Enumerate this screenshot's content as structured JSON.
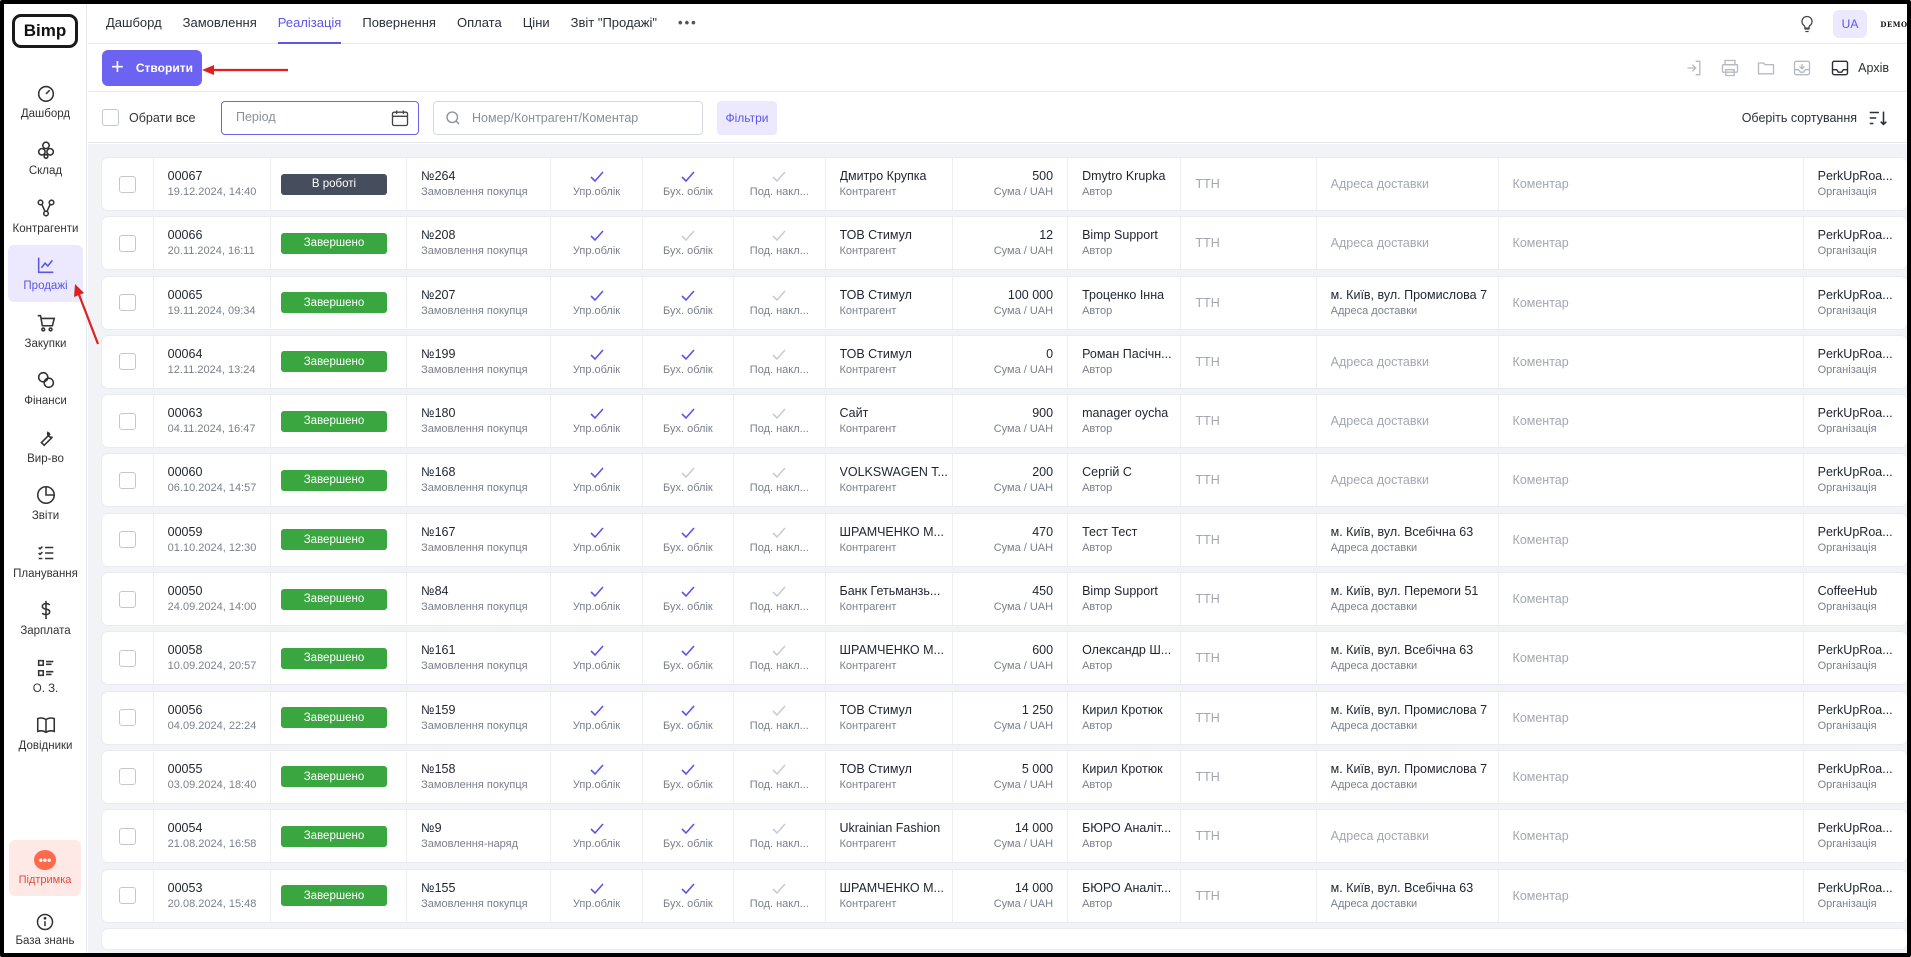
{
  "logo": "Bimp",
  "sidebar": {
    "items": [
      {
        "label": "Дашборд",
        "icon": "speedometer-icon",
        "active": false
      },
      {
        "label": "Склад",
        "icon": "boxes-icon",
        "active": false
      },
      {
        "label": "Контрагенти",
        "icon": "network-icon",
        "active": false
      },
      {
        "label": "Продажі",
        "icon": "chart-line-icon",
        "active": true
      },
      {
        "label": "Закупки",
        "icon": "cart-icon",
        "active": false
      },
      {
        "label": "Фінанси",
        "icon": "coins-icon",
        "active": false
      },
      {
        "label": "Вир-во",
        "icon": "wrench-icon",
        "active": false
      },
      {
        "label": "Звіти",
        "icon": "pie-chart-icon",
        "active": false
      },
      {
        "label": "Планування",
        "icon": "checklist-icon",
        "active": false
      },
      {
        "label": "Зарплата",
        "icon": "dollar-icon",
        "active": false
      },
      {
        "label": "О. З.",
        "icon": "grid-list-icon",
        "active": false
      },
      {
        "label": "Довідники",
        "icon": "book-icon",
        "active": false
      }
    ],
    "support_label": "Підтримка",
    "knowledge_label": "База знань"
  },
  "topnav": {
    "tabs": [
      {
        "label": "Дашборд",
        "active": false
      },
      {
        "label": "Замовлення",
        "active": false
      },
      {
        "label": "Реалізація",
        "active": true
      },
      {
        "label": "Повернення",
        "active": false
      },
      {
        "label": "Оплата",
        "active": false
      },
      {
        "label": "Ціни",
        "active": false
      },
      {
        "label": "Звіт \"Продажі\"",
        "active": false
      }
    ],
    "more": "•••",
    "lang": "UA",
    "demo": "DEMO"
  },
  "actions": {
    "create_label": "Створити",
    "archive_label": "Архів"
  },
  "filters": {
    "select_all": "Обрати все",
    "period_placeholder": "Період",
    "search_placeholder": "Номер/Контрагент/Коментар",
    "filters_label": "Фільтри",
    "sort_label": "Оберіть сортування"
  },
  "labels": {
    "upr": "Упр.облік",
    "buh": "Бух. облік",
    "pod": "Под. накл...",
    "counterparty": "Контрагент",
    "sum": "Сума / UAH",
    "author": "Автор",
    "ttn": "ТТН",
    "address": "Адреса доставки",
    "comment": "Коментар",
    "org": "Організація"
  },
  "colors": {
    "accent": "#6c63f2",
    "done": "#3aa640",
    "in_work": "#464e5e",
    "check_on": "#5b55e8",
    "check_off": "#c9ccd4"
  },
  "rows": [
    {
      "num": "00067",
      "date": "19.12.2024, 14:40",
      "status": "В роботі",
      "status_type": "work",
      "doc": "№264",
      "doc_type": "Замовлення покупця",
      "upr": true,
      "buh": true,
      "pod": false,
      "counterparty": "Дмитро Крупка",
      "sum": "500",
      "author": "Dmytro Krupka",
      "address": "",
      "org": "PerkUpRoa..."
    },
    {
      "num": "00066",
      "date": "20.11.2024, 16:11",
      "status": "Завершено",
      "status_type": "done",
      "doc": "№208",
      "doc_type": "Замовлення покупця",
      "upr": true,
      "buh": false,
      "pod": false,
      "counterparty": "ТОВ Стимул",
      "sum": "12",
      "author": "Bimp Support",
      "address": "",
      "org": "PerkUpRoa..."
    },
    {
      "num": "00065",
      "date": "19.11.2024, 09:34",
      "status": "Завершено",
      "status_type": "done",
      "doc": "№207",
      "doc_type": "Замовлення покупця",
      "upr": true,
      "buh": true,
      "pod": false,
      "counterparty": "ТОВ Стимул",
      "sum": "100 000",
      "author": "Троценко Інна",
      "address": "м. Київ, вул. Промислова 7",
      "org": "PerkUpRoa..."
    },
    {
      "num": "00064",
      "date": "12.11.2024, 13:24",
      "status": "Завершено",
      "status_type": "done",
      "doc": "№199",
      "doc_type": "Замовлення покупця",
      "upr": true,
      "buh": true,
      "pod": false,
      "counterparty": "ТОВ Стимул",
      "sum": "0",
      "author": "Роман Пасічн...",
      "address": "",
      "org": "PerkUpRoa..."
    },
    {
      "num": "00063",
      "date": "04.11.2024, 16:47",
      "status": "Завершено",
      "status_type": "done",
      "doc": "№180",
      "doc_type": "Замовлення покупця",
      "upr": true,
      "buh": true,
      "pod": false,
      "counterparty": "Сайт",
      "sum": "900",
      "author": "manager oycha",
      "address": "",
      "org": "PerkUpRoa..."
    },
    {
      "num": "00060",
      "date": "06.10.2024, 14:57",
      "status": "Завершено",
      "status_type": "done",
      "doc": "№168",
      "doc_type": "Замовлення покупця",
      "upr": true,
      "buh": false,
      "pod": false,
      "counterparty": "VOLKSWAGEN T...",
      "sum": "200",
      "author": "Сергій С",
      "address": "",
      "org": "PerkUpRoa..."
    },
    {
      "num": "00059",
      "date": "01.10.2024, 12:30",
      "status": "Завершено",
      "status_type": "done",
      "doc": "№167",
      "doc_type": "Замовлення покупця",
      "upr": true,
      "buh": true,
      "pod": false,
      "counterparty": "ШРАМЧЕНКО М...",
      "sum": "470",
      "author": "Тест Тест",
      "address": "м. Київ, вул. Всебічна 63",
      "org": "PerkUpRoa..."
    },
    {
      "num": "00050",
      "date": "24.09.2024, 14:00",
      "status": "Завершено",
      "status_type": "done",
      "doc": "№84",
      "doc_type": "Замовлення покупця",
      "upr": true,
      "buh": true,
      "pod": false,
      "counterparty": "Банк Гетьманзь...",
      "sum": "450",
      "author": "Bimp Support",
      "address": "м. Київ, вул. Перемоги 51",
      "org": "CoffeeHub"
    },
    {
      "num": "00058",
      "date": "10.09.2024, 20:57",
      "status": "Завершено",
      "status_type": "done",
      "doc": "№161",
      "doc_type": "Замовлення покупця",
      "upr": true,
      "buh": true,
      "pod": false,
      "counterparty": "ШРАМЧЕНКО М...",
      "sum": "600",
      "author": "Олександр Ш...",
      "address": "м. Київ, вул. Всебічна 63",
      "org": "PerkUpRoa..."
    },
    {
      "num": "00056",
      "date": "04.09.2024, 22:24",
      "status": "Завершено",
      "status_type": "done",
      "doc": "№159",
      "doc_type": "Замовлення покупця",
      "upr": true,
      "buh": true,
      "pod": false,
      "counterparty": "ТОВ Стимул",
      "sum": "1 250",
      "author": "Кирил Кротюк",
      "address": "м. Київ, вул. Промислова 7",
      "org": "PerkUpRoa..."
    },
    {
      "num": "00055",
      "date": "03.09.2024, 18:40",
      "status": "Завершено",
      "status_type": "done",
      "doc": "№158",
      "doc_type": "Замовлення покупця",
      "upr": true,
      "buh": true,
      "pod": false,
      "counterparty": "ТОВ Стимул",
      "sum": "5 000",
      "author": "Кирил Кротюк",
      "address": "м. Київ, вул. Промислова 7",
      "org": "PerkUpRoa..."
    },
    {
      "num": "00054",
      "date": "21.08.2024, 16:58",
      "status": "Завершено",
      "status_type": "done",
      "doc": "№9",
      "doc_type": "Замовлення-наряд",
      "upr": true,
      "buh": true,
      "pod": false,
      "counterparty": "Ukrainian Fashion",
      "sum": "14 000",
      "author": "БЮРО Аналіт...",
      "address": "",
      "org": "PerkUpRoa..."
    },
    {
      "num": "00053",
      "date": "20.08.2024, 15:48",
      "status": "Завершено",
      "status_type": "done",
      "doc": "№155",
      "doc_type": "Замовлення покупця",
      "upr": true,
      "buh": true,
      "pod": false,
      "counterparty": "ШРАМЧЕНКО М...",
      "sum": "14 000",
      "author": "БЮРО Аналіт...",
      "address": "м. Київ, вул. Всебічна 63",
      "org": "PerkUpRoa..."
    }
  ]
}
